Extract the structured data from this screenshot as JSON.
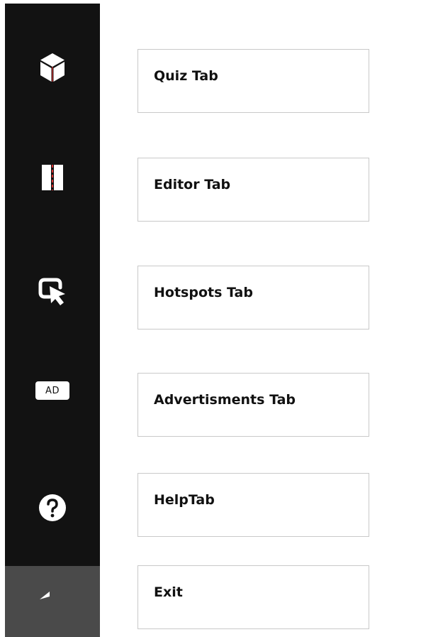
{
  "sidebar": {
    "items": [
      {
        "name": "quiz",
        "icon": "cube-icon"
      },
      {
        "name": "editor",
        "icon": "book-icon"
      },
      {
        "name": "hotspots",
        "icon": "cursor-select-icon"
      },
      {
        "name": "advertisements",
        "icon": "ad-icon",
        "badge_text": "AD"
      },
      {
        "name": "help",
        "icon": "question-icon"
      },
      {
        "name": "back",
        "icon": "reply-arrow-icon",
        "active": true
      }
    ]
  },
  "tabs": [
    {
      "label": "Quiz Tab"
    },
    {
      "label": "Editor Tab"
    },
    {
      "label": "Hotspots Tab"
    },
    {
      "label": "Advertisments Tab"
    },
    {
      "label": "HelpTab"
    },
    {
      "label": "Exit"
    }
  ],
  "colors": {
    "sidebar_bg": "#121212",
    "sidebar_active_bg": "#4a4a4a",
    "icon": "#ffffff",
    "accent_red": "#d32f2f",
    "box_border": "#c9c9c9",
    "text": "#111111"
  }
}
